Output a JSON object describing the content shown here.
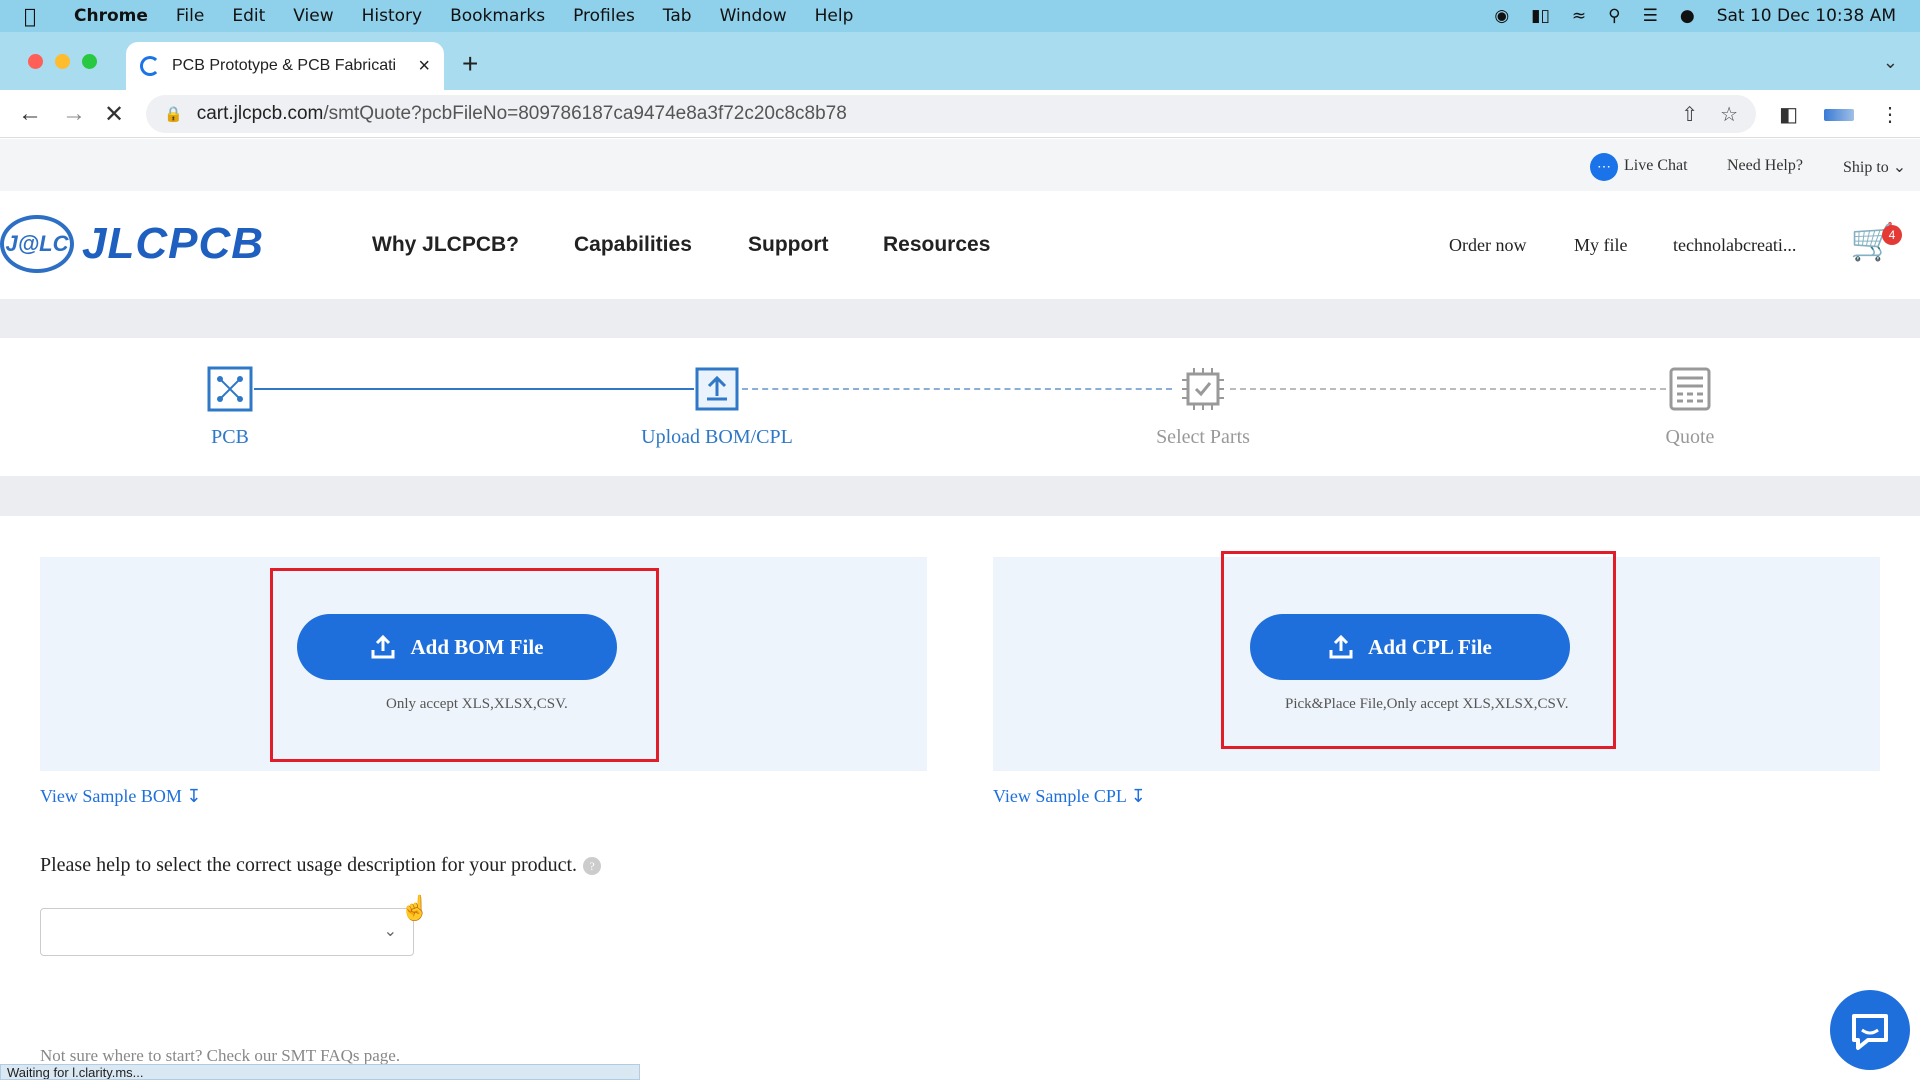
{
  "menubar": {
    "app": "Chrome",
    "items": [
      "File",
      "Edit",
      "View",
      "History",
      "Bookmarks",
      "Profiles",
      "Tab",
      "Window",
      "Help"
    ],
    "datetime": "Sat 10 Dec  10:38 AM"
  },
  "browser": {
    "tab_title": "PCB Prototype & PCB Fabricati",
    "url_host": "cart.jlcpcb.com",
    "url_path": "/smtQuote?pcbFileNo=809786187ca9474e8a3f72c20c8c8b78"
  },
  "utility": {
    "live_chat": "Live Chat",
    "need_help": "Need Help?",
    "ship_to": "Ship to"
  },
  "header": {
    "logo_mark": "J@LC",
    "logo_text": "JLCPCB",
    "nav": [
      "Why JLCPCB?",
      "Capabilities",
      "Support",
      "Resources"
    ],
    "order_now": "Order now",
    "my_file": "My file",
    "user": "technolabcreati...",
    "cart_count": "4"
  },
  "steps": [
    {
      "label": "PCB",
      "state": "done"
    },
    {
      "label": "Upload BOM/CPL",
      "state": "active"
    },
    {
      "label": "Select Parts",
      "state": "pending"
    },
    {
      "label": "Quote",
      "state": "pending"
    }
  ],
  "upload": {
    "bom_button": "Add BOM File",
    "bom_hint": "Only accept XLS,XLSX,CSV.",
    "cpl_button": "Add CPL File",
    "cpl_hint": "Pick&Place File,Only accept XLS,XLSX,CSV.",
    "sample_bom": "View Sample BOM",
    "sample_cpl": "View Sample CPL"
  },
  "usage": {
    "question": "Please help to select the correct usage description for your product.",
    "select_value": ""
  },
  "faq_text": "Not sure where to start? Check our SMT FAQs page.",
  "status_text": "Waiting for l.clarity.ms...",
  "colors": {
    "accent": "#1e6fdc",
    "highlight_box": "#e11d2a",
    "panel_bg": "#eef4fb"
  }
}
